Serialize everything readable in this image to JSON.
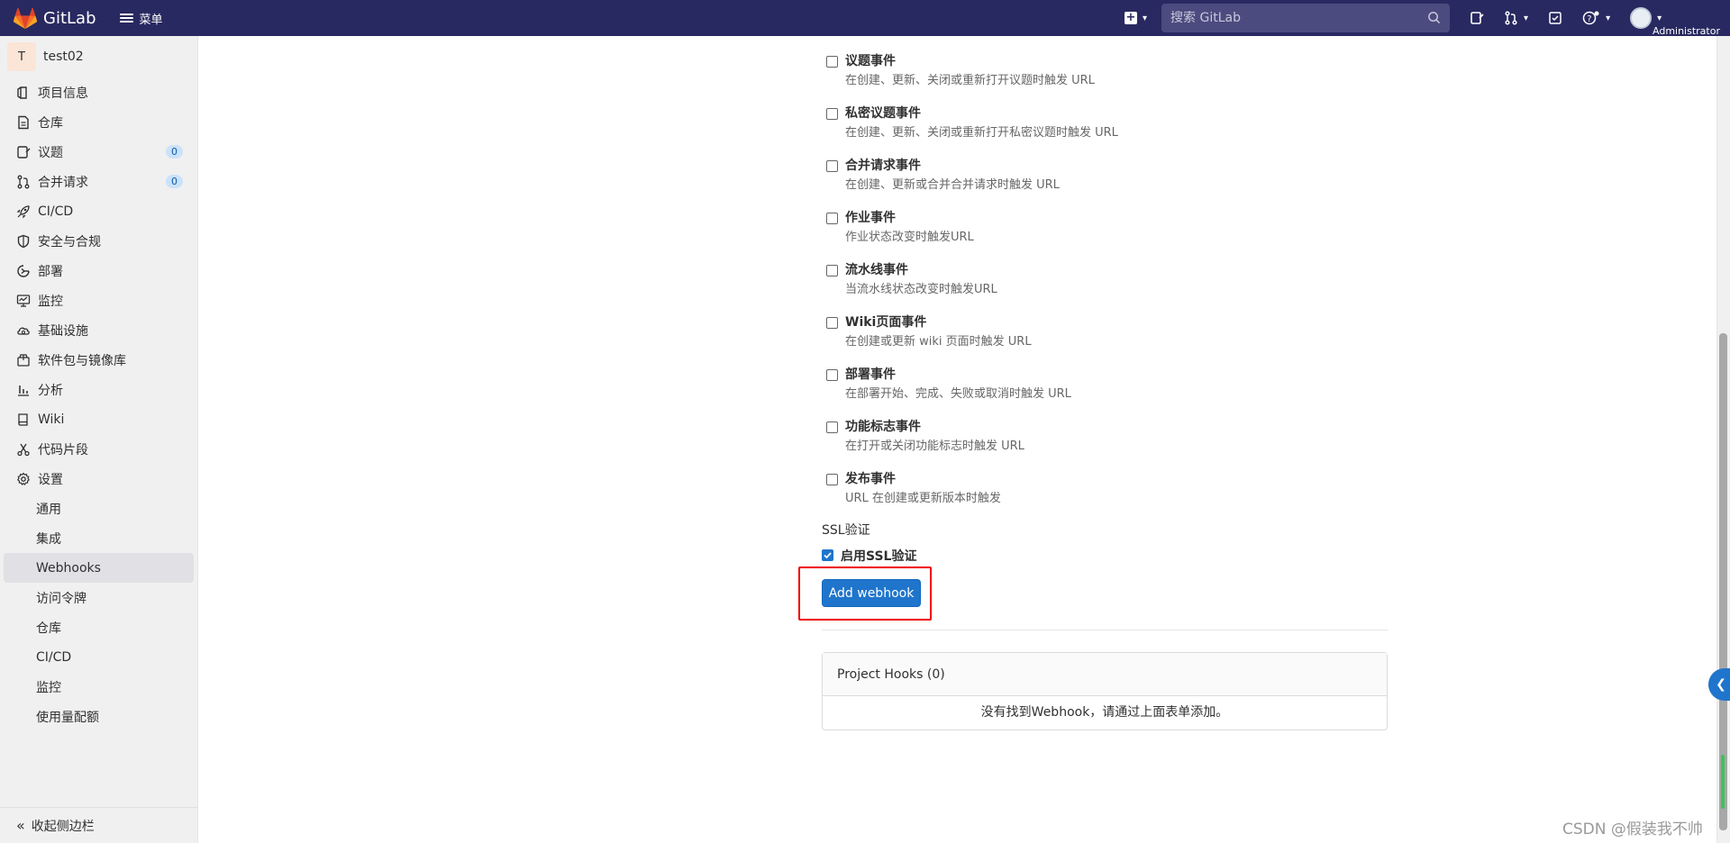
{
  "navbar": {
    "brand": "GitLab",
    "menu_label": "菜单",
    "search_placeholder": "搜索 GitLab",
    "user_label": "Administrator"
  },
  "sidebar": {
    "project_initial": "T",
    "project_name": "test02",
    "items": [
      {
        "label": "项目信息",
        "icon": "project-icon"
      },
      {
        "label": "仓库",
        "icon": "repository-icon"
      },
      {
        "label": "议题",
        "icon": "issues-icon",
        "badge": "0"
      },
      {
        "label": "合并请求",
        "icon": "merge-request-icon",
        "badge": "0"
      },
      {
        "label": "CI/CD",
        "icon": "rocket-icon"
      },
      {
        "label": "安全与合规",
        "icon": "shield-icon"
      },
      {
        "label": "部署",
        "icon": "deployments-icon"
      },
      {
        "label": "监控",
        "icon": "monitor-icon"
      },
      {
        "label": "基础设施",
        "icon": "cloud-icon"
      },
      {
        "label": "软件包与镜像库",
        "icon": "package-icon"
      },
      {
        "label": "分析",
        "icon": "chart-icon"
      },
      {
        "label": "Wiki",
        "icon": "book-icon"
      },
      {
        "label": "代码片段",
        "icon": "snippet-icon"
      },
      {
        "label": "设置",
        "icon": "gear-icon"
      }
    ],
    "sub_items": [
      "通用",
      "集成",
      "Webhooks",
      "访问令牌",
      "仓库",
      "CI/CD",
      "监控",
      "使用量配额"
    ],
    "active_sub": "Webhooks",
    "collapse_label": "收起侧边栏"
  },
  "events": [
    {
      "title": "议题事件",
      "desc": "在创建、更新、关闭或重新打开议题时触发 URL",
      "checked": false
    },
    {
      "title": "私密议题事件",
      "desc": "在创建、更新、关闭或重新打开私密议题时触发 URL",
      "checked": false
    },
    {
      "title": "合并请求事件",
      "desc": "在创建、更新或合并合并请求时触发 URL",
      "checked": false
    },
    {
      "title": "作业事件",
      "desc": "作业状态改变时触发URL",
      "checked": false
    },
    {
      "title": "流水线事件",
      "desc": "当流水线状态改变时触发URL",
      "checked": false
    },
    {
      "title": "Wiki页面事件",
      "desc": "在创建或更新 wiki 页面时触发 URL",
      "checked": false
    },
    {
      "title": "部署事件",
      "desc": "在部署开始、完成、失败或取消时触发 URL",
      "checked": false
    },
    {
      "title": "功能标志事件",
      "desc": "在打开或关闭功能标志时触发 URL",
      "checked": false
    },
    {
      "title": "发布事件",
      "desc": "URL 在创建或更新版本时触发",
      "checked": false
    }
  ],
  "ssl": {
    "section_label": "SSL验证",
    "checkbox_label": "启用SSL验证",
    "checked": true
  },
  "add_button_label": "Add webhook",
  "hooks": {
    "header": "Project Hooks (0)",
    "empty_text": "没有找到Webhook，请通过上面表单添加。"
  },
  "watermark": "CSDN @假装我不帅",
  "colors": {
    "navbar_bg": "#292961",
    "primary_button": "#1f75cb",
    "highlight_border": "#e00000",
    "badge_bg": "#cbe2f9"
  }
}
